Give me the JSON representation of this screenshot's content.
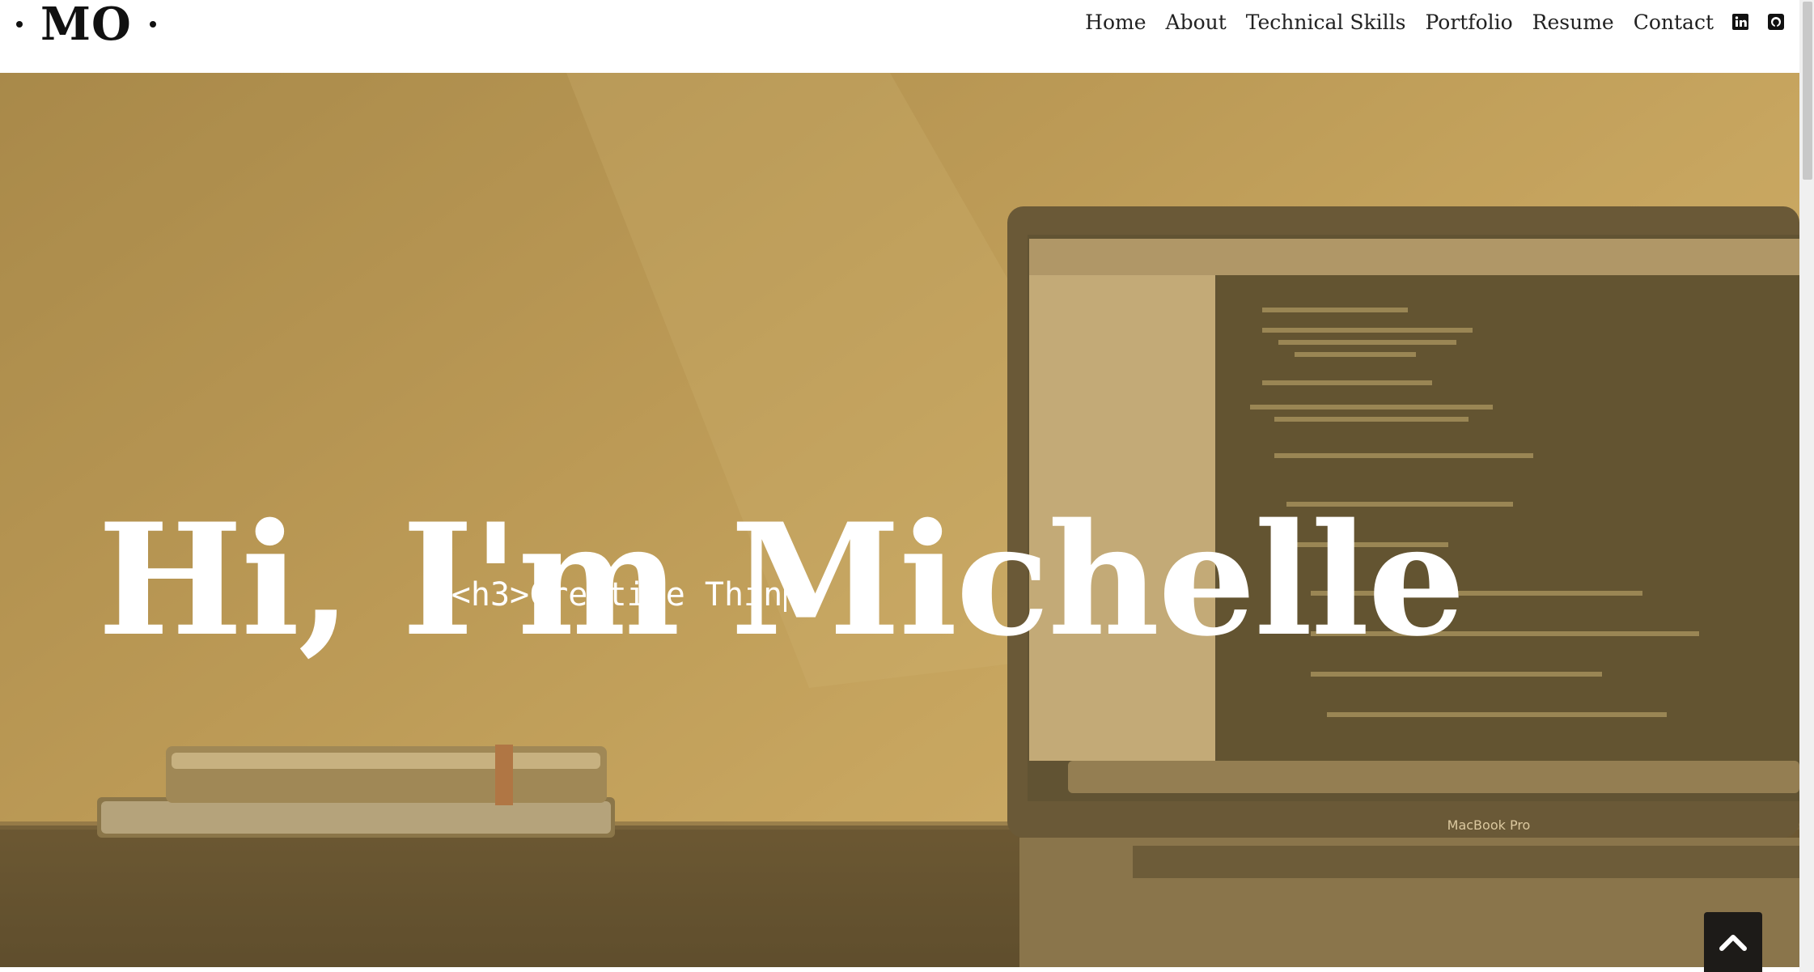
{
  "brand": {
    "initials": "MO"
  },
  "nav": {
    "links": [
      {
        "label": "Home"
      },
      {
        "label": "About"
      },
      {
        "label": "Technical Skills"
      },
      {
        "label": "Portfolio"
      },
      {
        "label": "Resume"
      },
      {
        "label": "Contact"
      }
    ],
    "icons": [
      {
        "name": "linkedin-icon"
      },
      {
        "name": "github-icon"
      }
    ]
  },
  "hero": {
    "title": "Hi, I'm Michelle",
    "typed_text": "<h3>Creative Thin",
    "background_image": {
      "laptop_brand": "MacBook Pro"
    },
    "overlay_color": "#c4a052"
  },
  "back_to_top": {
    "icon": "chevron-up-icon"
  }
}
